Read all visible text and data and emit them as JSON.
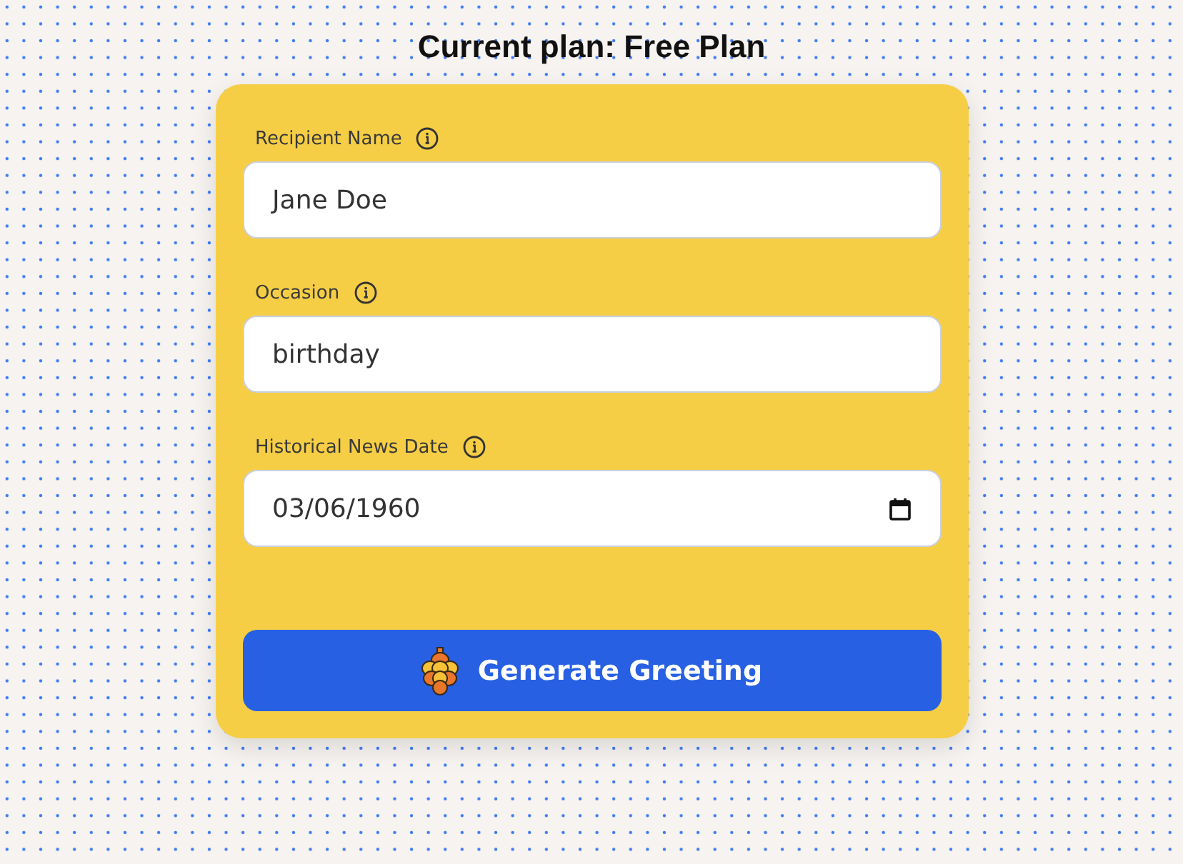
{
  "heading": "Current plan: Free Plan",
  "fields": [
    {
      "kind": "text",
      "label": "Recipient Name",
      "value": "Jane Doe"
    },
    {
      "kind": "text",
      "label": "Occasion",
      "value": "birthday"
    },
    {
      "kind": "date",
      "label": "Historical News Date",
      "value": "03/06/1960"
    }
  ],
  "submit_button": {
    "label": "Generate Greeting"
  }
}
